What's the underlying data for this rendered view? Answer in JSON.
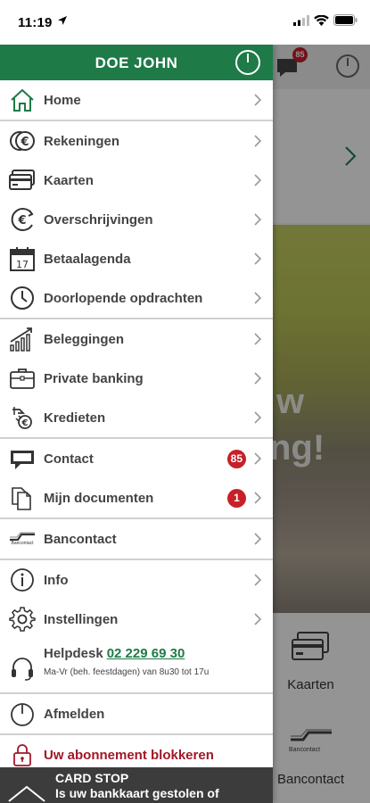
{
  "status_bar": {
    "time": "11:19"
  },
  "background": {
    "badge_count": "85",
    "photo_text_line1": "w",
    "photo_text_line2": "ng!",
    "tile_kaarten": "Kaarten",
    "tile_bancontact": "Bancontact",
    "bancontact_logo_text": "Bancontact"
  },
  "drawer": {
    "user_name": "DOE JOHN",
    "menu": {
      "home": "Home",
      "rekeningen": "Rekeningen",
      "kaarten": "Kaarten",
      "overschrijvingen": "Overschrijvingen",
      "betaalagenda": "Betaalagenda",
      "calendar_day": "17",
      "doorlopende": "Doorlopende opdrachten",
      "beleggingen": "Beleggingen",
      "private_banking": "Private banking",
      "kredieten": "Kredieten",
      "contact": "Contact",
      "contact_badge": "85",
      "mijn_documenten": "Mijn documenten",
      "documenten_badge": "1",
      "bancontact": "Bancontact",
      "bancontact_logo_text": "Bancontact",
      "info": "Info",
      "instellingen": "Instellingen",
      "afmelden": "Afmelden",
      "blokkeren": "Uw abonnement blokkeren"
    },
    "helpdesk": {
      "label": "Helpdesk",
      "phone": "02 229 69 30",
      "hours": "Ma-Vr (beh. feestdagen) van 8u30 tot 17u"
    },
    "cardstop": {
      "title": "CARD STOP",
      "subtitle": "Is uw bankkaart gestolen of"
    }
  },
  "colors": {
    "brand_green": "#1e7a47",
    "badge_red": "#c62028",
    "block_red": "#a01828"
  }
}
